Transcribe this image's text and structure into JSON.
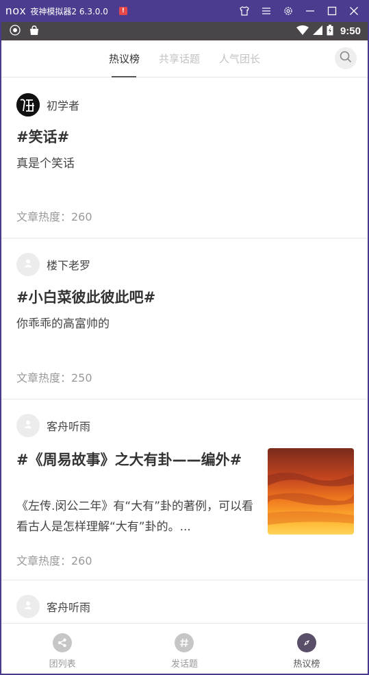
{
  "emulator": {
    "logo": "nox",
    "title": "夜神模拟器2 6.3.0.0",
    "warning": "!"
  },
  "status_bar": {
    "time": "9:50"
  },
  "top_tabs": [
    {
      "label": "热议榜",
      "active": true
    },
    {
      "label": "共享话题",
      "active": false
    },
    {
      "label": "人气团长",
      "active": false
    }
  ],
  "posts": [
    {
      "author": "初学者",
      "title": "#笑话#",
      "description": "真是个笑话",
      "heat": "文章热度：260",
      "has_image": false
    },
    {
      "author": "楼下老罗",
      "title": "#小白菜彼此彼此吧#",
      "description": "你乖乖的高富帅的",
      "heat": "文章热度：250",
      "has_image": false
    },
    {
      "author": "客舟听雨",
      "title": "#《周易故事》之大有卦——编外#",
      "description": "《左传.闵公二年》有“大有”卦的著例，可以看看古人是怎样理解“大有”卦的。...",
      "heat": "文章热度：260",
      "has_image": true
    },
    {
      "author": "客舟听雨"
    }
  ],
  "bottom_nav": [
    {
      "label": "团列表",
      "icon": "share-icon",
      "active": false
    },
    {
      "label": "发话题",
      "icon": "hashtag-icon",
      "active": false
    },
    {
      "label": "热议榜",
      "icon": "compass-icon",
      "active": true
    }
  ],
  "colors": {
    "emulator_bar": "#4b3c8f",
    "status_bar": "#4a4548",
    "active_nav": "#5a4f68"
  }
}
